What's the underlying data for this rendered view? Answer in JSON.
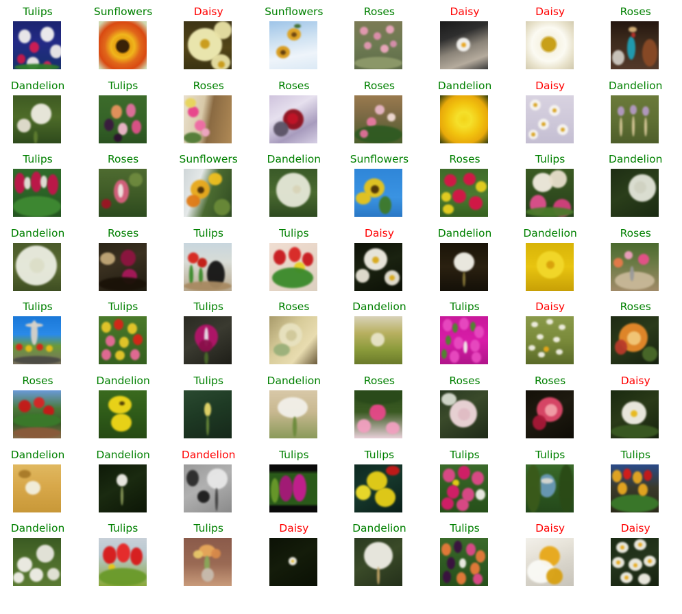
{
  "figure": {
    "type": "image-classification-grid",
    "rows": 8,
    "columns": 8,
    "total_cells": 64,
    "label_colors": {
      "correct": "#008000",
      "incorrect": "#ff0000"
    },
    "classes": [
      "Tulips",
      "Sunflowers",
      "Daisy",
      "Roses",
      "Dandelion"
    ]
  },
  "cells": [
    {
      "label": "Tulips",
      "status": "correct",
      "subject": "white-and-red-tulip-field"
    },
    {
      "label": "Sunflowers",
      "status": "correct",
      "subject": "red-orange-sunflower-closeup"
    },
    {
      "label": "Daisy",
      "status": "incorrect",
      "subject": "pale-yellow-daisies"
    },
    {
      "label": "Sunflowers",
      "status": "correct",
      "subject": "two-sunflowers-blue-sky"
    },
    {
      "label": "Roses",
      "status": "correct",
      "subject": "pink-rose-bush"
    },
    {
      "label": "Daisy",
      "status": "incorrect",
      "subject": "daisy-in-hands-monochrome"
    },
    {
      "label": "Daisy",
      "status": "incorrect",
      "subject": "white-daisy-yellow-center"
    },
    {
      "label": "Roses",
      "status": "correct",
      "subject": "rider-on-horse-teal-outfit"
    },
    {
      "label": "Dandelion",
      "status": "correct",
      "subject": "two-dandelion-seedheads-green"
    },
    {
      "label": "Tulips",
      "status": "correct",
      "subject": "mixed-color-tulip-bed"
    },
    {
      "label": "Roses",
      "status": "correct",
      "subject": "pink-roses-bouquet-on-deck"
    },
    {
      "label": "Roses",
      "status": "correct",
      "subject": "red-rose-on-lavender-cloth"
    },
    {
      "label": "Roses",
      "status": "correct",
      "subject": "pink-roses-in-garden"
    },
    {
      "label": "Dandelion",
      "status": "correct",
      "subject": "yellow-dandelion-bloom"
    },
    {
      "label": "Daisy",
      "status": "incorrect",
      "subject": "daisies-among-twigs"
    },
    {
      "label": "Dandelion",
      "status": "correct",
      "subject": "three-dandelion-buds"
    },
    {
      "label": "Tulips",
      "status": "correct",
      "subject": "red-white-striped-tulips"
    },
    {
      "label": "Roses",
      "status": "correct",
      "subject": "pink-tulip-in-grass"
    },
    {
      "label": "Sunflowers",
      "status": "correct",
      "subject": "sunflower-against-building"
    },
    {
      "label": "Dandelion",
      "status": "correct",
      "subject": "dandelion-seedhead-macro"
    },
    {
      "label": "Sunflowers",
      "status": "correct",
      "subject": "sunflower-blue-sky"
    },
    {
      "label": "Roses",
      "status": "correct",
      "subject": "red-roses-with-yellow"
    },
    {
      "label": "Tulips",
      "status": "correct",
      "subject": "white-and-pink-tulips"
    },
    {
      "label": "Dandelion",
      "status": "correct",
      "subject": "dandelion-clock-dark-green"
    },
    {
      "label": "Dandelion",
      "status": "correct",
      "subject": "large-dandelion-seedhead"
    },
    {
      "label": "Roses",
      "status": "correct",
      "subject": "dark-magenta-roses"
    },
    {
      "label": "Tulips",
      "status": "correct",
      "subject": "red-tulips-with-cat"
    },
    {
      "label": "Tulips",
      "status": "correct",
      "subject": "red-tulip-bouquet-mimosa"
    },
    {
      "label": "Daisy",
      "status": "incorrect",
      "subject": "white-daisies-dark-background"
    },
    {
      "label": "Dandelion",
      "status": "correct",
      "subject": "dandelion-puff-dark-ground"
    },
    {
      "label": "Dandelion",
      "status": "correct",
      "subject": "yellow-dandelion-on-gold"
    },
    {
      "label": "Roses",
      "status": "correct",
      "subject": "garden-sundial-with-roses"
    },
    {
      "label": "Tulips",
      "status": "correct",
      "subject": "monument-with-tulip-beds"
    },
    {
      "label": "Tulips",
      "status": "correct",
      "subject": "mixed-tulip-field"
    },
    {
      "label": "Tulips",
      "status": "correct",
      "subject": "single-magenta-tulip"
    },
    {
      "label": "Roses",
      "status": "correct",
      "subject": "cream-rose-decoration"
    },
    {
      "label": "Dandelion",
      "status": "correct",
      "subject": "dandelion-in-golden-meadow"
    },
    {
      "label": "Tulips",
      "status": "correct",
      "subject": "magenta-tulip-buds-mass"
    },
    {
      "label": "Daisy",
      "status": "incorrect",
      "subject": "daisy-meadow"
    },
    {
      "label": "Roses",
      "status": "correct",
      "subject": "orange-rose-with-dew"
    },
    {
      "label": "Roses",
      "status": "correct",
      "subject": "red-roses-garden-sky"
    },
    {
      "label": "Dandelion",
      "status": "correct",
      "subject": "two-yellow-dandelions-grass"
    },
    {
      "label": "Tulips",
      "status": "correct",
      "subject": "single-yellow-tulip-bud"
    },
    {
      "label": "Dandelion",
      "status": "correct",
      "subject": "white-dandelion-clock-tan"
    },
    {
      "label": "Roses",
      "status": "correct",
      "subject": "pink-rose-in-bush"
    },
    {
      "label": "Roses",
      "status": "correct",
      "subject": "pale-pink-rose"
    },
    {
      "label": "Roses",
      "status": "correct",
      "subject": "coral-rose-dark-background"
    },
    {
      "label": "Daisy",
      "status": "incorrect",
      "subject": "single-white-daisy-green"
    },
    {
      "label": "Dandelion",
      "status": "correct",
      "subject": "dandelion-in-golden-field"
    },
    {
      "label": "Dandelion",
      "status": "correct",
      "subject": "dandelion-bud-dark-green"
    },
    {
      "label": "Dandelion",
      "status": "incorrect",
      "subject": "dandelion-clock-grayscale"
    },
    {
      "label": "Tulips",
      "status": "correct",
      "subject": "magenta-tulips-black-frame"
    },
    {
      "label": "Tulips",
      "status": "correct",
      "subject": "yellow-tulips-closeup"
    },
    {
      "label": "Tulips",
      "status": "correct",
      "subject": "pink-tulip-field"
    },
    {
      "label": "Tulips",
      "status": "correct",
      "subject": "blue-house-among-trees"
    },
    {
      "label": "Tulips",
      "status": "correct",
      "subject": "yellow-and-red-tulip-rows"
    },
    {
      "label": "Dandelion",
      "status": "correct",
      "subject": "dandelion-field-white-puffs"
    },
    {
      "label": "Tulips",
      "status": "correct",
      "subject": "red-tulips-bright"
    },
    {
      "label": "Tulips",
      "status": "correct",
      "subject": "orange-tulips-in-vase"
    },
    {
      "label": "Daisy",
      "status": "incorrect",
      "subject": "tiny-daisy-dark-grass"
    },
    {
      "label": "Dandelion",
      "status": "correct",
      "subject": "dandelion-seedhead-centered"
    },
    {
      "label": "Tulips",
      "status": "correct",
      "subject": "purple-orange-tulip-field"
    },
    {
      "label": "Daisy",
      "status": "incorrect",
      "subject": "daisy-macro-white-yellow"
    },
    {
      "label": "Daisy",
      "status": "incorrect",
      "subject": "daisy-cluster-dark-green"
    }
  ]
}
